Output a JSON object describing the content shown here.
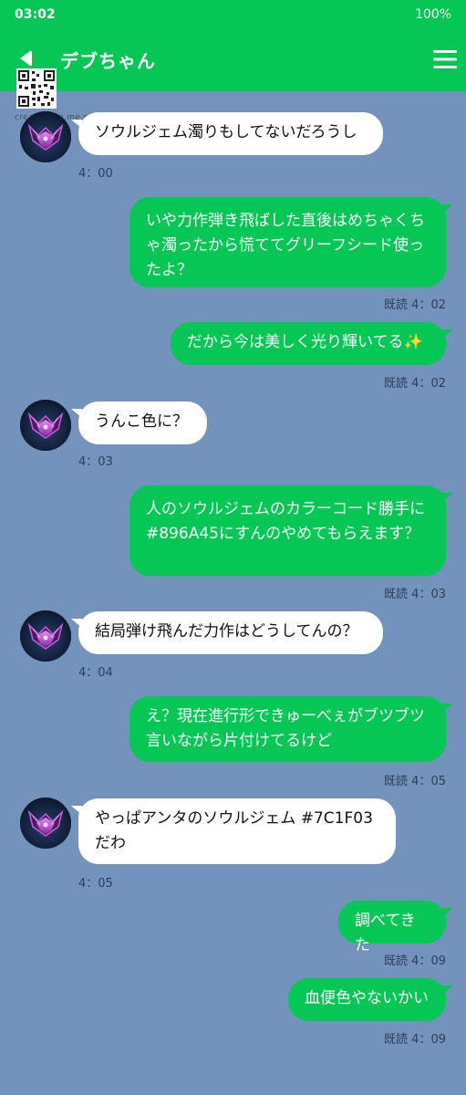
{
  "status_bar": {
    "time": "03:02",
    "battery": "100%"
  },
  "header": {
    "title": "デブちゃん"
  },
  "watermark": "creator.line.me.st",
  "colors": {
    "header": "#06c755",
    "background": "#7393bd",
    "outgoing_bubble": "#06c755",
    "incoming_bubble": "#ffffff"
  },
  "messages": [
    {
      "direction": "incoming",
      "text": "ソウルジェム濁りもしてないだろうし",
      "time": "4：00"
    },
    {
      "direction": "outgoing",
      "text": "いや力作弾き飛ばした直後はめちゃくちゃ濁ったから慌ててグリーフシード使ったよ？",
      "time": "既読 4：02"
    },
    {
      "direction": "outgoing",
      "text": "だから今は美しく光り輝いてる✨",
      "time": "既読 4：02"
    },
    {
      "direction": "incoming",
      "text": "うんこ色に？",
      "time": "4：03"
    },
    {
      "direction": "outgoing",
      "text": "人のソウルジェムのカラーコード勝手に#896A45にすんのやめてもらえます？",
      "time": "既読 4：03"
    },
    {
      "direction": "incoming",
      "text": "結局弾け飛んだ力作はどうしてんの？",
      "time": "4：04"
    },
    {
      "direction": "outgoing",
      "text": "え？現在進行形できゅーべぇがブツブツ言いながら片付けてるけど",
      "time": "既読 4：05"
    },
    {
      "direction": "incoming",
      "text": "やっぱアンタのソウルジェム #7C1F03だわ",
      "time": "4：05"
    },
    {
      "direction": "outgoing",
      "text": "調べてきた",
      "time": "既読 4：09"
    },
    {
      "direction": "outgoing",
      "text": "血便色やないかい",
      "time": "既読 4：09"
    }
  ]
}
